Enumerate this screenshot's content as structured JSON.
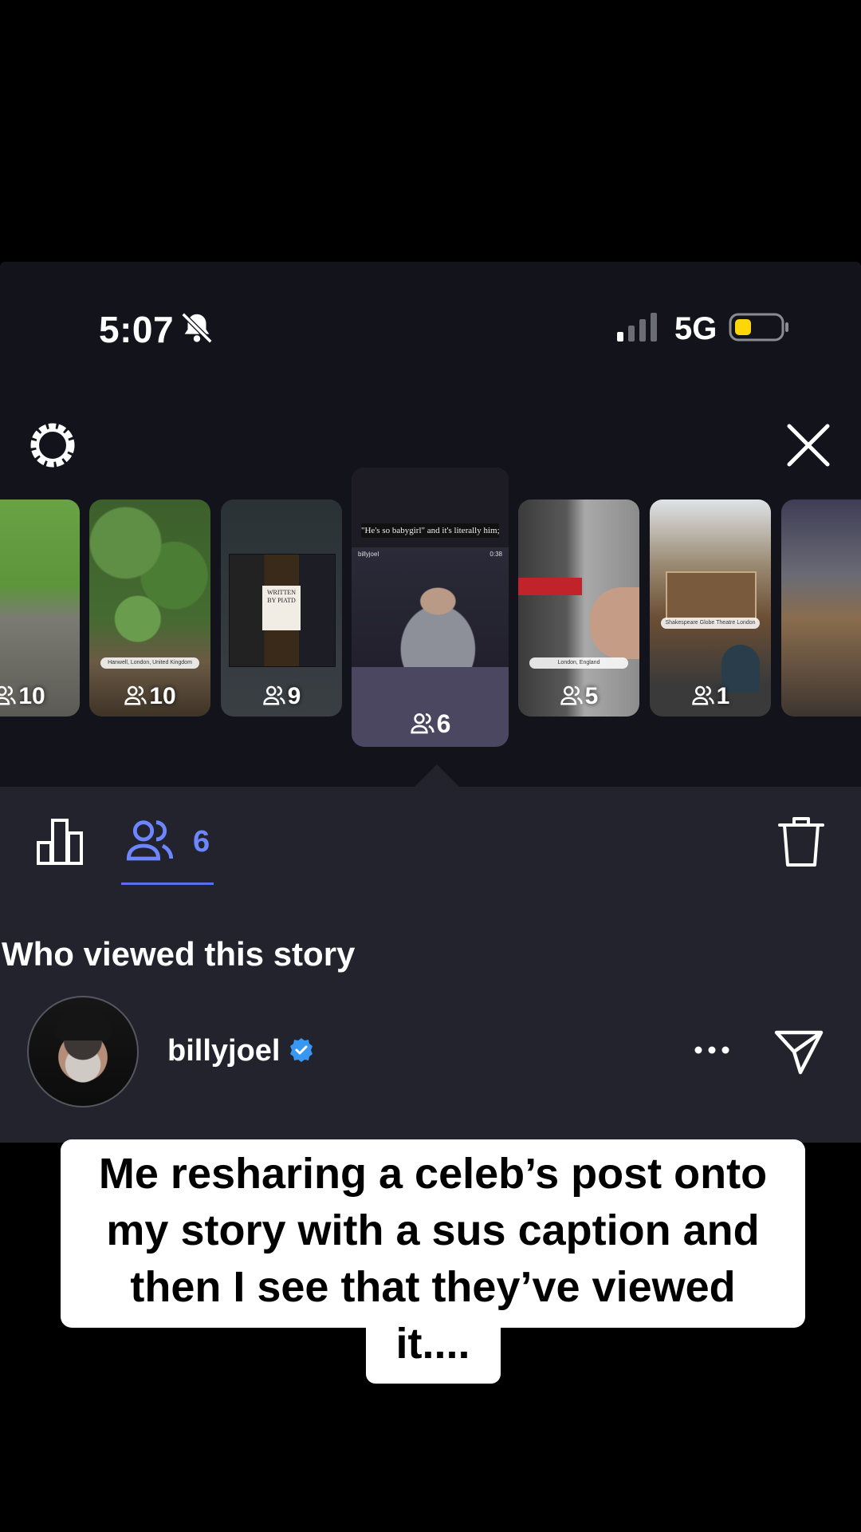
{
  "status_bar": {
    "time": "5:07",
    "network": "5G"
  },
  "stories": [
    {
      "views": "10",
      "location": ""
    },
    {
      "views": "10",
      "location": "Hanwell, London, United Kingdom"
    },
    {
      "views": "9",
      "location": ""
    },
    {
      "views": "6",
      "caption": "\"He's so babygirl\" and it's literally him;",
      "video_user": "billyjoel",
      "video_time": "0:38",
      "active": true
    },
    {
      "views": "5",
      "location": "London, England"
    },
    {
      "views": "1",
      "location": "Shakespeare Globe Theatre London"
    },
    {
      "views": "",
      "location": ""
    }
  ],
  "story_collage": {
    "title": "WRITTEN BY PIATD"
  },
  "tabs": {
    "viewers_count": "6"
  },
  "section_title": "Who viewed this story",
  "viewer": {
    "username": "billyjoel"
  },
  "meme_caption": {
    "line1": "Me resharing a celeb’s post onto",
    "line2": "my story with a sus caption and",
    "line3": "then I see that they’ve viewed",
    "line4": "it...."
  },
  "colors": {
    "accent": "#5b6df1",
    "accent_text": "#6d86ff",
    "verified": "#3897f0",
    "battery": "#ffd60a"
  }
}
